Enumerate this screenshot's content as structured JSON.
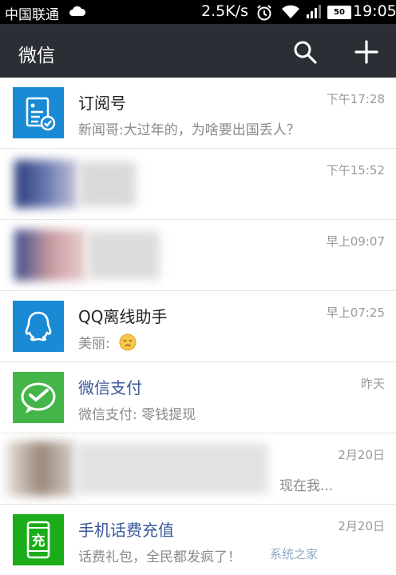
{
  "status_bar": {
    "carrier": "中国联通",
    "net_speed": "2.5K/s",
    "battery": "50",
    "time": "19:05"
  },
  "header": {
    "title": "微信"
  },
  "chats": [
    {
      "name": "订阅号",
      "preview": "新闻哥:大过年的，为啥要出国丢人？",
      "time": "下午17:28",
      "avatar_icon": "subscription-icon"
    },
    {
      "name": "",
      "preview": "",
      "time": "下午15:52",
      "avatar_icon": "blurred-avatar"
    },
    {
      "name": "",
      "preview": "",
      "time": "早上09:07",
      "avatar_icon": "blurred-avatar"
    },
    {
      "name": "QQ离线助手",
      "preview": "美丽:",
      "time": "早上07:25",
      "avatar_icon": "qq-penguin-icon"
    },
    {
      "name": "微信支付",
      "preview": "微信支付: 零钱提现",
      "time": "昨天",
      "avatar_icon": "wechat-pay-icon"
    },
    {
      "name": "",
      "preview": "现在我...",
      "time": "2月20日",
      "avatar_icon": "blurred-avatar"
    },
    {
      "name": "手机话费充值",
      "preview": "话费礼包，全民都发疯了！",
      "time": "2月20日",
      "avatar_icon": "phone-recharge-icon",
      "avatar_text": "充"
    }
  ],
  "watermark": "系统之家",
  "colors": {
    "app_bar": "#2b2e34",
    "accent_blue": "#1a8ad4",
    "wechat_green": "#44b549",
    "recharge_green": "#1aad19"
  }
}
